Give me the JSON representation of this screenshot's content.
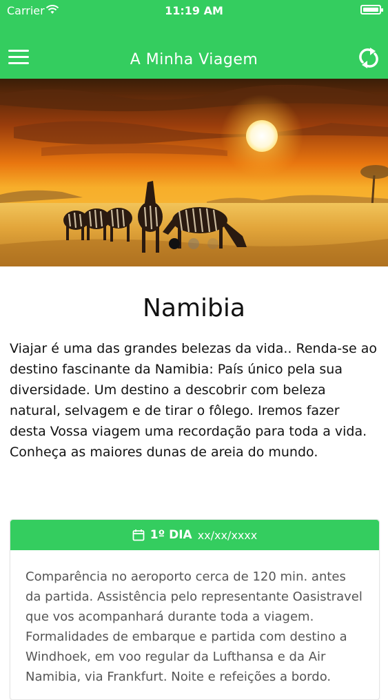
{
  "status_bar": {
    "carrier": "Carrier",
    "time": "11:19 AM",
    "icons": [
      "wifi-icon",
      "battery-icon"
    ]
  },
  "header": {
    "title": "A Minha Viagem",
    "menu_icon": "hamburger-menu-icon",
    "action_icon": "sync-refresh-icon"
  },
  "carousel": {
    "image": "sunset-savanna-zebras",
    "pages": 3,
    "active_page": 1
  },
  "destination": {
    "name": "Namibia",
    "description": "Viajar é uma das grandes belezas da vida.. Renda-se ao destino fascinante da Namibia: País único pela sua diversidade. Um destino a descobrir com beleza natural, selvagem e de tirar o fôlego. Iremos fazer desta Vossa viagem uma recordação para toda a vida. Conheça as maiores dunas de areia do mundo."
  },
  "itinerary": {
    "days": [
      {
        "label": "1º DIA",
        "date": "xx/xx/xxxx",
        "icon": "calendar-icon",
        "text": "Comparência no aeroporto cerca de 120 min. antes da partida. Assistência pelo representante Oasistravel que vos acompanhará durante toda a viagem. Formalidades de embarque e partida com destino a Windhoek, em voo regular da Lufthansa e da Air Namibia, via Frankfurt. Noite e refeições a bordo."
      }
    ]
  },
  "colors": {
    "primary": "#34cd5f",
    "text": "#111111",
    "muted_text": "#555555"
  }
}
